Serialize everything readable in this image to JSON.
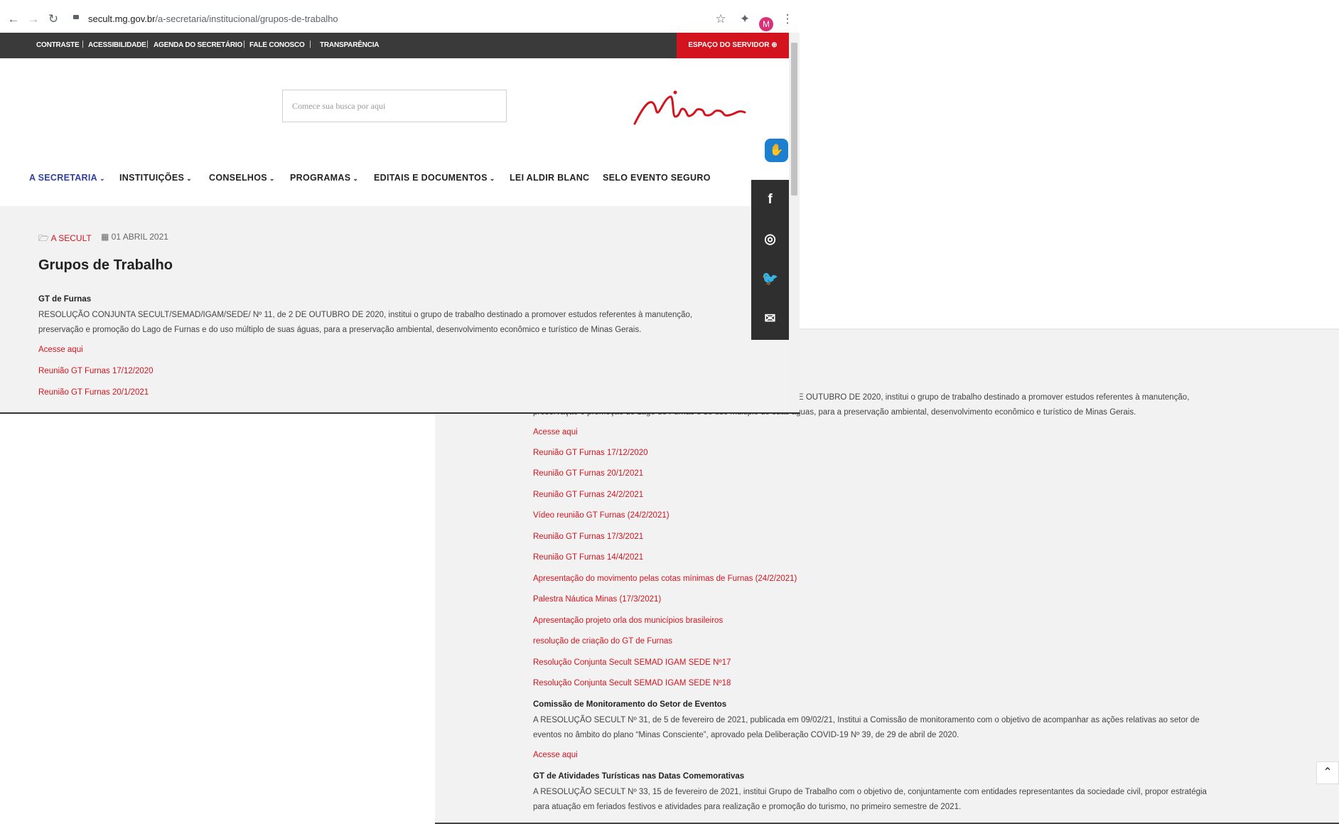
{
  "browser": {
    "url_domain": "secult.mg.gov.br",
    "url_path": "/a-secretaria/institucional/grupos-de-trabalho",
    "avatar_letter": "M"
  },
  "topbar": {
    "links": [
      "CONTRASTE",
      "ACESSIBILIDADE",
      "AGENDA DO SECRETÁRIO",
      "FALE CONOSCO",
      "TRANSPARÊNCIA"
    ],
    "servidor_label": "ESPAÇO DO SERVIDOR"
  },
  "search": {
    "placeholder": "Comece sua busca por aqui"
  },
  "logo_text": "Minas",
  "menu": [
    "A SECRETARIA",
    "INSTITUIÇÕES",
    "CONSELHOS",
    "PROGRAMAS",
    "EDITAIS E DOCUMENTOS",
    "LEI ALDIR BLANC",
    "SELO EVENTO SEGURO"
  ],
  "article": {
    "category": "A SECULT",
    "date": "01 ABRIL 2021",
    "title": "Grupos de Trabalho",
    "gt_furnas_heading": "GT de Furnas",
    "gt_furnas_p1": "RESOLUÇÃO CONJUNTA SECULT/SEMAD/IGAM/SEDE/ Nº 11, de 2 DE OUTUBRO DE 2020, institui o grupo de trabalho destinado a promover estudos referentes à manutenção,",
    "gt_furnas_p2": "preservação e promoção do Lago de Furnas e do uso múltiplo de suas águas, para a preservação ambiental, desenvolvimento econômico e turístico de Minas Gerais.",
    "gt_furnas_p1_tail": "E OUTUBRO DE 2020, institui o grupo de trabalho destinado a promover estudos referentes à manutenção,",
    "gt_furnas_p2_tail": "preservação e promoção do Lago de Furnas e do uso múltiplo de suas águas, para a preservação ambiental, desenvolvimento econômico e turístico de Minas Gerais.",
    "links": [
      "Acesse aqui",
      "Reunião GT Furnas 17/12/2020",
      "Reunião GT Furnas 20/1/2021",
      "Reunião GT Furnas 24/2/2021",
      "Vídeo reunião GT Furnas (24/2/2021)",
      "Reunião GT Furnas 17/3/2021",
      "Reunião GT Furnas 14/4/2021",
      "Apresentação do movimento pelas cotas mínimas de Furnas (24/2/2021)",
      "Palestra Náutica Minas (17/3/2021)",
      "Apresentação projeto orla dos municípios brasileiros",
      "resolução de criação do GT de Furnas",
      "Resolução Conjunta Secult SEMAD IGAM SEDE Nº17",
      "Resolução Conjunta Secult SEMAD IGAM SEDE Nº18"
    ],
    "eventos_heading": "Comissão de Monitoramento do Setor de Eventos",
    "eventos_p1": "A RESOLUÇÃO SECULT Nº 31, de 5 de fevereiro de 2021, publicada em 09/02/21, Institui a Comissão de monitoramento com o objetivo de acompanhar as ações relativas ao setor de",
    "eventos_p2": "eventos no âmbito do plano “Minas Consciente”, aprovado pela Deliberação COVID-19 Nº 39, de 29 de abril de 2020.",
    "eventos_link": "Acesse aqui",
    "turisticas_heading": "GT de Atividades  Turísticas nas Datas Comemorativas",
    "turisticas_p1": " A RESOLUÇÃO SECULT Nº 33, 15 de fevereiro de 2021, institui Grupo de Trabalho com o objetivo de, conjuntamente com entidades representantes da sociedade civil, propor estratégia",
    "turisticas_p2": "para atuação em feriados festivos e atividades para realização e promoção do turismo, no primeiro semestre de 2021."
  },
  "colors": {
    "accent_red": "#d3141e",
    "menu_active": "#2f3fa0",
    "topbar": "#3a3a3a"
  }
}
